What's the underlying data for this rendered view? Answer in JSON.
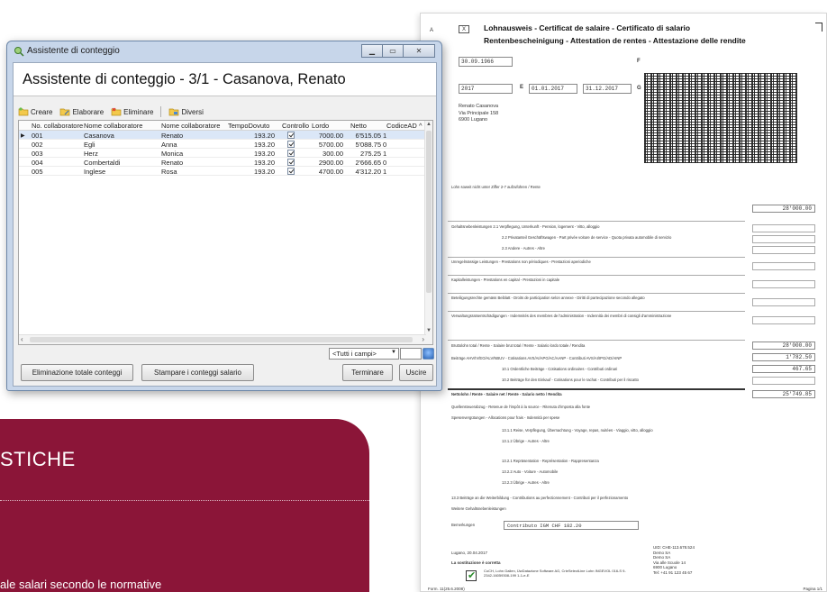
{
  "document": {
    "letter_a": "A",
    "letter_a_box": "X",
    "title_line1": "Lohnausweis - Certificat de salaire - Certificato di salario",
    "title_line2": "Rentenbescheinigung - Attestation de rentes - Attestazione delle rendite",
    "birth_date": "30.09.1966",
    "year": "2017",
    "letter_e": "E",
    "period_from": "01.01.2017",
    "period_to": "31.12.2017",
    "letter_f": "F",
    "letter_g": "G",
    "address_name": "Renato Casanova",
    "address_street": "Via Principale 158",
    "address_city": "6900 Lugano",
    "row_lohn": "Lohn  soweit nicht unter Ziffer 2-7 aufzuführen / Rente",
    "row_benefits": "Gehaltsnebenleistungen  2.1 Verpflegung, Unterkunft - Pension, logement - Vitto, alloggio",
    "row_car": "2.2 Privatanteil Geschäftswagen - Part privée voiture de service - Quota privata automobile di servizio",
    "row_other": "2.3 Andere - Autres - Altre",
    "row_irregular": "Unregelmässige Leistungen - Prestations non périodiques - Prestazioni aperiodiche",
    "row_capital": "Kapitalleistungen - Prestations en capital - Prestazioni in capitale",
    "row_participation": "Beteiligungsrechte gemäss Beiblatt - Droits de participation selon annexe - Diritti di partecipazione secondo allegato",
    "row_board": "Verwaltungsratsentschädigungen - Indemnités des membres de l'administration - Indennità dei membri di consigli d'amministrazione",
    "row_gross": "Bruttolohn total / Rente - Salaire brut total / Rente - Salario lordo totale / Rendita",
    "row_ahv": "Beiträge AHV/IV/EO/ALV/NBUV - Cotisations AVS/AI/APG/AC/AANP - Contributi AVS/AI/IPG/AD/AINP",
    "row_bvg1": "10.1 Ordentliche Beiträge - Cotisations ordinaires - Contributi ordinari",
    "row_bvg2": "10.2 Beiträge für den Einkauf - Cotisations pour le rachat - Contributi per il riscatto",
    "row_net": "Nettolohn / Rente - Salaire net / Rente - Salario netto / Rendita",
    "row_source": "Quellensteuerabzug - Retenue de l'impôt à la source - Ritenuta d'imposta alla fonte",
    "row_expenses": "Spesenvergütungen - Allocations pour frais - Indennità per spese",
    "row_actual": "13.1.1 Reise, Verpflegung, Übernachtung - Voyage, repas, nuitées - Viaggio, vitto, alloggio",
    "row_actual2": "13.1.2 Übrige - Autres - Altre",
    "row_flat": "13.2.1 Repräsentation - Représentation - Rappresentanza",
    "row_flat2": "13.2.2 Auto - Voiture - Automobile",
    "row_flat3": "13.2.3 Übrige - Autres - Altre",
    "row_training": "13.3 Beiträge an die Weiterbildung - Contributions au perfectionnement - Contributi per il perfezionamento",
    "row_further": "Weitere Gehaltsnebenleistungen",
    "row_remarks": "Bemerkungen",
    "amt_salary": "28'000.00",
    "amt_gross": "28'000.00",
    "amt_ahv": "1'782.50",
    "amt_bvg": "467.65",
    "amt_net": "25'749.85",
    "remark_value": "Contributo IGM CHF 182.20",
    "place_date": "Lugano, 20.04.2017",
    "sig_label": "La sostituzione è corretta",
    "sig_text": "CoCH, Lohn Gallen, ÜwDatazione Software AG, CrieSelectLine Lohn INGEVOL 016-S 9-2342-16059308-199 1-1-e-E",
    "uid_block": "UID: CHE-113.678.524\nDemo SA\nDemo SA\nVia alle Scuole 14\n6900 Lugano\nTel: +41 91 123 45 67",
    "footer_left": "Form. 11(25.6.2008)",
    "footer_right": "Pagina 1/1"
  },
  "banner": {
    "heading": "STICHE",
    "text": "ale salari secondo le normative"
  },
  "window": {
    "title": "Assistente di conteggio",
    "main_title": "Assistente di conteggio - 3/1 - Casanova, Renato",
    "toolbar": {
      "create": "Creare",
      "process": "Elaborare",
      "delete": "Eliminare",
      "various": "Diversi"
    },
    "grid": {
      "headers": [
        "No. collaboratore",
        "Nome collaboratore",
        "Nome collaboratore",
        "TempoDovuto",
        "Controllo",
        "Lordo",
        "Netto",
        "CodiceAD"
      ],
      "rows": [
        {
          "no": "001",
          "surname": "Casanova",
          "name": "Renato",
          "tempo": "193.20",
          "lordo": "7000.00",
          "netto": "6'515.05",
          "code": "1",
          "selected": true
        },
        {
          "no": "002",
          "surname": "Egli",
          "name": "Anna",
          "tempo": "193.20",
          "lordo": "5700.00",
          "netto": "5'088.75",
          "code": "0",
          "selected": false
        },
        {
          "no": "003",
          "surname": "Herz",
          "name": "Monica",
          "tempo": "193.20",
          "lordo": "300.00",
          "netto": "275.25",
          "code": "1",
          "selected": false
        },
        {
          "no": "004",
          "surname": "Combertaldi",
          "name": "Renato",
          "tempo": "193.20",
          "lordo": "2900.00",
          "netto": "2'666.65",
          "code": "0",
          "selected": false
        },
        {
          "no": "005",
          "surname": "Inglese",
          "name": "Rosa",
          "tempo": "193.20",
          "lordo": "4700.00",
          "netto": "4'312.20",
          "code": "1",
          "selected": false
        }
      ]
    },
    "filter": {
      "selected": "<Tutti i campi>"
    },
    "buttons": {
      "delete_all": "Eliminazione totale conteggi",
      "print": "Stampare i conteggi salario",
      "finish": "Terminare",
      "exit": "Uscire"
    }
  },
  "colors": {
    "banner": "#8b1538",
    "selection": "#dbe7f7",
    "window_frame": "#c7d6ea"
  }
}
